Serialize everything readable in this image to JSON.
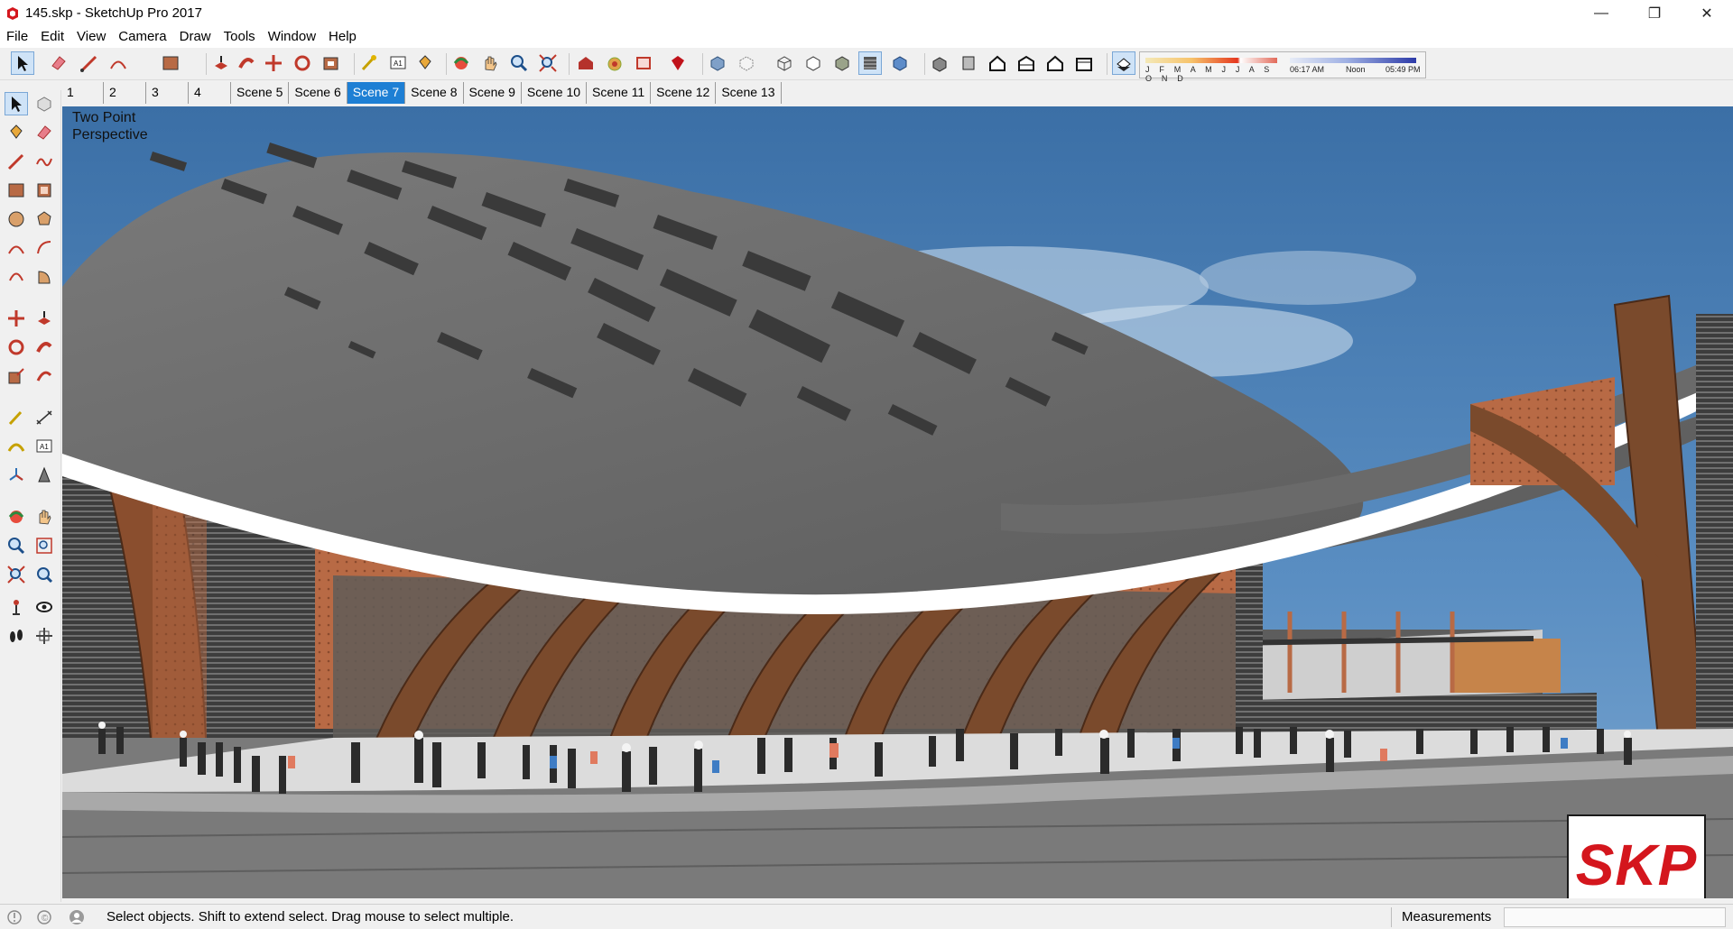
{
  "window": {
    "title": "145.skp - SketchUp Pro 2017",
    "minimize": "—",
    "maximize": "❐",
    "close": "✕"
  },
  "menu": [
    "File",
    "Edit",
    "View",
    "Camera",
    "Draw",
    "Tools",
    "Window",
    "Help"
  ],
  "toolbar_icons": [
    "select-icon",
    "eraser-icon",
    "line-icon",
    "arc-icon",
    "rectangle-icon",
    "push-pull-icon",
    "follow-me-icon",
    "move-icon",
    "rotate-icon",
    "offset-icon",
    "tape-measure-icon",
    "text-icon",
    "paint-bucket-icon",
    "orbit-icon",
    "pan-icon",
    "zoom-icon",
    "zoom-extents-icon",
    "warehouse-icon",
    "extension-warehouse-icon",
    "layout-icon",
    "ruby-icon",
    "x-ray-icon",
    "back-edges-icon",
    "wireframe-icon",
    "hidden-line-icon",
    "shaded-icon",
    "shaded-textures-icon",
    "monochrome-icon",
    "iso-view-icon",
    "top-view-icon",
    "front-view-icon",
    "right-view-icon",
    "back-view-icon",
    "left-view-icon",
    "shadows-toggle-icon"
  ],
  "shadows": {
    "months": "J F M A M J J A S O N D",
    "time_start": "06:17 AM",
    "time_mid": "Noon",
    "time_end": "05:49 PM"
  },
  "scene_tabs": [
    {
      "label": "1",
      "active": false
    },
    {
      "label": "2",
      "active": false
    },
    {
      "label": "3",
      "active": false
    },
    {
      "label": "4",
      "active": false
    },
    {
      "label": "Scene 5",
      "active": false
    },
    {
      "label": "Scene 6",
      "active": false
    },
    {
      "label": "Scene 7",
      "active": true
    },
    {
      "label": "Scene 8",
      "active": false
    },
    {
      "label": "Scene 9",
      "active": false
    },
    {
      "label": "Scene 10",
      "active": false
    },
    {
      "label": "Scene 11",
      "active": false
    },
    {
      "label": "Scene 12",
      "active": false
    },
    {
      "label": "Scene 13",
      "active": false
    }
  ],
  "viewport": {
    "view_label": "Two Point Perspective",
    "badge": "SKP"
  },
  "colors": {
    "sky": "#4a7eb4",
    "roof": "#6b6b6b",
    "roof_edge": "#ffffff",
    "brick": "#b86a45",
    "ground": "#7a7a7a",
    "accent": "#1e7fd4",
    "badge_red": "#d4161d"
  },
  "status": {
    "message": "Select objects. Shift to extend select. Drag mouse to select multiple.",
    "measurements_label": "Measurements",
    "measurements_value": ""
  }
}
